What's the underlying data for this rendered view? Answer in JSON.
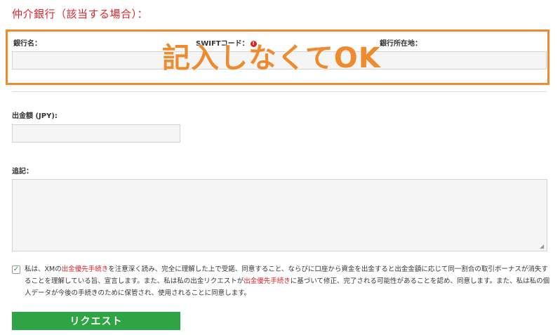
{
  "section_title": "仲介銀行（該当する場合）：",
  "bank": {
    "name_label": "銀行名：",
    "swift_label": "SWIFTコード：",
    "swift_info_icon": "info-icon",
    "location_label": "銀行所在地："
  },
  "overlay_note": "記入しなくてOK",
  "amount": {
    "label": "出金額 (JPY):",
    "value": ""
  },
  "notes": {
    "label": "追記：",
    "value": ""
  },
  "consent": {
    "checked": true,
    "part1": "私は、XMの",
    "link1": "出金優先手続き",
    "part2": "を注意深く読み、完全に理解した上で受諾、同意すること、ならびに口座から資金を出金すると出金金額に応じて同一割合の取引ボーナスが消失することを理解している旨、宣言します。また、私は私の出金リクエストが",
    "link2": "出金優先手続き",
    "part3": "に基づいて修正、完了される可能性があることを認め、同意します。また、私は私の個人データが今後の手続きのために保管され、使用されることに同意します。"
  },
  "submit_label": "リクエスト",
  "colors": {
    "accent_red": "#d9262c",
    "highlight_orange": "#f08a2e",
    "button_green": "#2ea445"
  }
}
